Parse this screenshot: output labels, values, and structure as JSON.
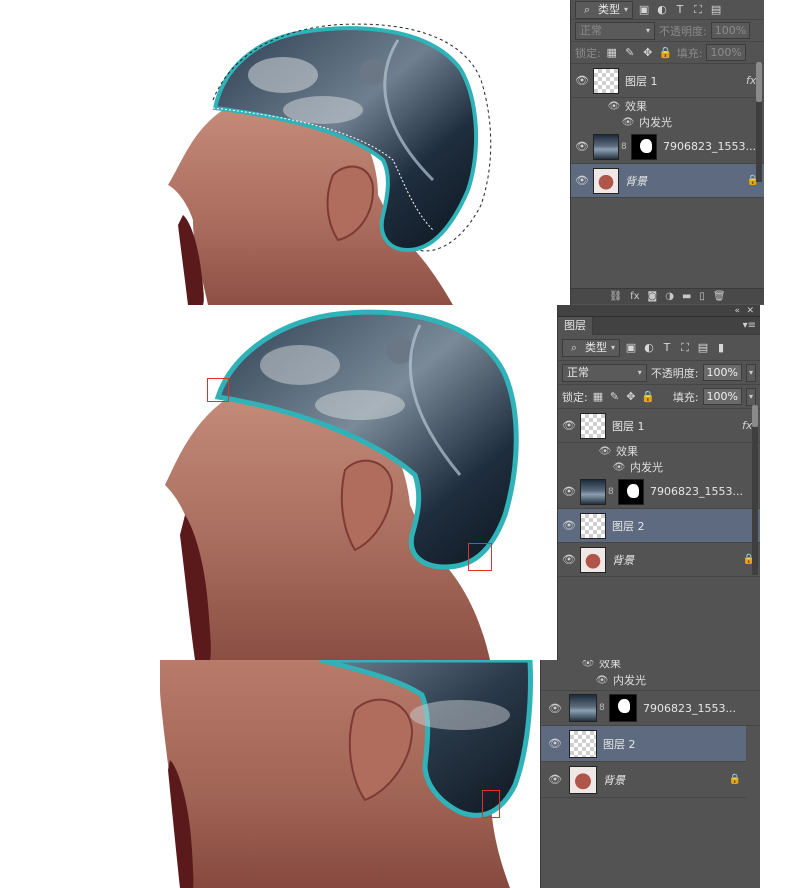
{
  "panels": [
    {
      "filter_label": "类型",
      "blend_mode": "正常",
      "opacity_label": "不透明度:",
      "opacity_value": "100%",
      "lock_label": "锁定:",
      "fill_label": "填充:",
      "fill_value": "100%",
      "layers": [
        {
          "name": "图层 1",
          "fx": "fx",
          "effects_label": "效果",
          "effect_item": "内发光"
        },
        {
          "name": "7906823_1553..."
        },
        {
          "name": "背景"
        }
      ]
    },
    {
      "tab_label": "图层",
      "filter_label": "类型",
      "blend_mode": "正常",
      "opacity_label": "不透明度:",
      "opacity_value": "100%",
      "lock_label": "锁定:",
      "fill_label": "填充:",
      "fill_value": "100%",
      "layers": [
        {
          "name": "图层 1",
          "fx": "fx",
          "effects_label": "效果",
          "effect_item": "内发光"
        },
        {
          "name": "7906823_1553..."
        },
        {
          "name": "图层 2"
        },
        {
          "name": "背景"
        }
      ]
    },
    {
      "effects_label": "效果",
      "effect_item": "内发光",
      "layers": [
        {
          "name": "7906823_1553..."
        },
        {
          "name": "图层 2"
        },
        {
          "name": "背景"
        }
      ]
    }
  ],
  "icons": {
    "eye": "eye-icon",
    "search": "search-icon",
    "lock": "lock-icon",
    "fx": "fx-icon",
    "chain": "link-icon"
  },
  "colors": {
    "panel_bg": "#535353",
    "selected_layer": "#5d6a80",
    "annotation_red": "#e0322b",
    "glow_cyan": "#2fb3b8"
  }
}
